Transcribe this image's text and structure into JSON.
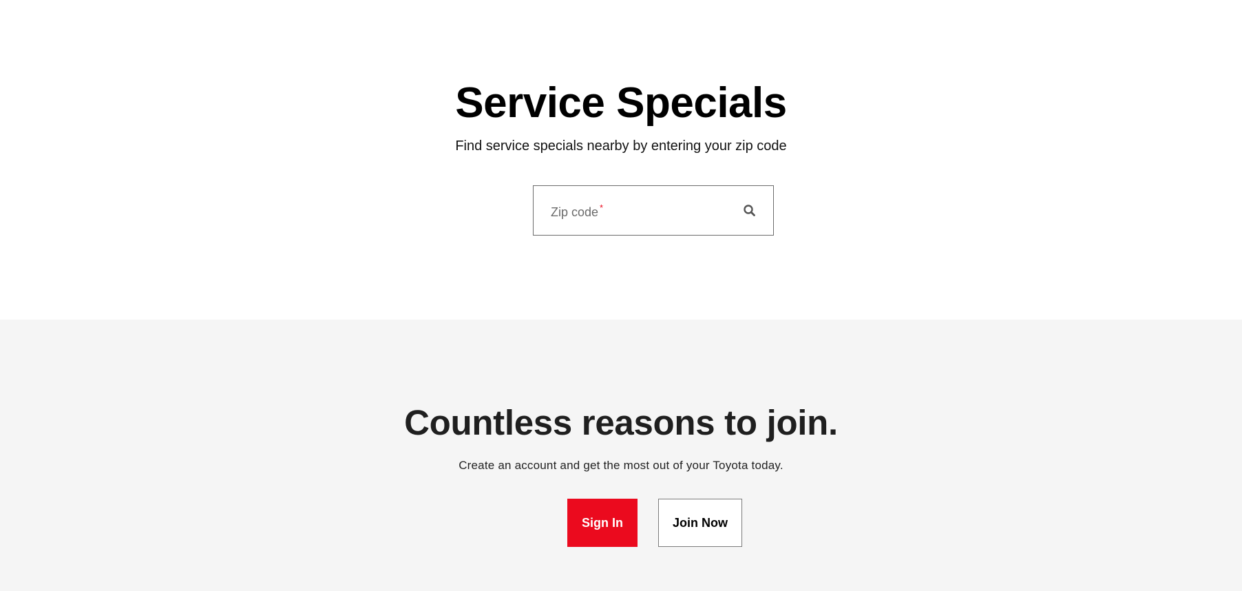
{
  "specials": {
    "title": "Service Specials",
    "subtitle": "Find service specials nearby by entering your zip code",
    "zip": {
      "label": "Zip code",
      "required_mark": "*",
      "value": "",
      "search_icon": "search-icon"
    }
  },
  "join": {
    "title": "Countless reasons to join.",
    "subtitle": "Create an account and get the most out of your Toyota today.",
    "sign_in_label": "Sign In",
    "join_now_label": "Join Now"
  },
  "colors": {
    "brand_red": "#eb0a1e",
    "section_gray": "#f5f5f5",
    "text_dark": "#000000"
  }
}
